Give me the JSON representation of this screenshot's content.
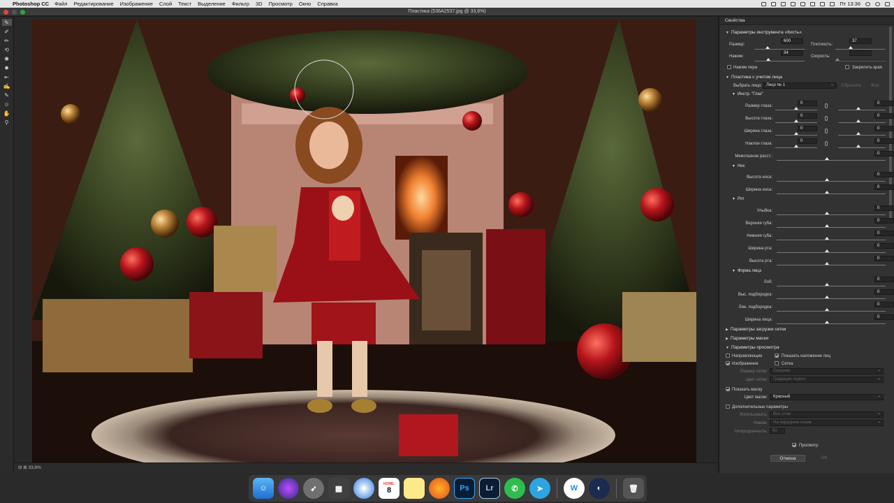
{
  "menubar": {
    "app_name": "Photoshop CC",
    "items": [
      "Файл",
      "Редактирование",
      "Изображение",
      "Слой",
      "Текст",
      "Выделение",
      "Фильтр",
      "3D",
      "Просмотр",
      "Окно",
      "Справка"
    ],
    "clock": "Пт 13:36"
  },
  "window": {
    "title": "Пластика (536A2537.jpg @ 33,6%)"
  },
  "statusbar": {
    "zoom": "33,6%"
  },
  "panel": {
    "header": "Свойства",
    "brush": {
      "title": "Параметры инструмента «Кисть»",
      "size_label": "Размер:",
      "size_value": "600",
      "density_label": "Плотность:",
      "density_value": "37",
      "pressure_label": "Нажим:",
      "pressure_value": "34",
      "rate_label": "Скорость:",
      "rate_value": "",
      "stylus_label": "Нажим пера",
      "pin_label": "Закрепить края"
    },
    "face": {
      "title": "Пластика с учетом лица",
      "select_label": "Выбрать лицо:",
      "select_value": "Лицо № 1",
      "reset_label": "Сбросить",
      "all_label": "Все",
      "eyes_title": "Инстр. \"Глаз\"",
      "eyes": [
        {
          "label": "Размер глаза:",
          "left": "0",
          "right": "0"
        },
        {
          "label": "Высота глаза:",
          "left": "0",
          "right": "0"
        },
        {
          "label": "Ширина глаза:",
          "left": "0",
          "right": "0"
        },
        {
          "label": "Наклон глаза:",
          "left": "0",
          "right": "0"
        }
      ],
      "eye_distance": {
        "label": "Межглазное расст.:",
        "value": "0"
      },
      "nose_title": "Нос",
      "nose": [
        {
          "label": "Высота носа:",
          "value": "0"
        },
        {
          "label": "Ширина носа:",
          "value": "0"
        }
      ],
      "mouth_title": "Рот",
      "mouth": [
        {
          "label": "Улыбка:",
          "value": "0"
        },
        {
          "label": "Верхняя губа:",
          "value": "0"
        },
        {
          "label": "Нижняя губа:",
          "value": "0"
        },
        {
          "label": "Ширина рта:",
          "value": "0"
        },
        {
          "label": "Высота рта:",
          "value": "0"
        }
      ],
      "shape_title": "Форма лица",
      "shape": [
        {
          "label": "Лоб:",
          "value": "0"
        },
        {
          "label": "Выс. подбородка:",
          "value": "0"
        },
        {
          "label": "Лин. подбородка:",
          "value": "0"
        },
        {
          "label": "Ширина лица:",
          "value": "0"
        }
      ]
    },
    "mesh_title": "Параметры загрузки сетки",
    "mask_title": "Параметры маски",
    "view": {
      "title": "Параметры просмотра",
      "guides_label": "Направляющие",
      "face_overlay_label": "Показать наложение лиц",
      "image_label": "Изображение",
      "mesh_label": "Сетка",
      "mesh_size_label": "Размер сетки:",
      "mesh_size_value": "Средние",
      "mesh_color_label": "Цвет сетки:",
      "mesh_color_value": "Градации серого",
      "show_mask_label": "Показать маску",
      "mask_color_label": "Цвет маски:",
      "mask_color_value": "Красный"
    },
    "extra": {
      "title": "Дополнительные параметры",
      "use_label": "Использовать:",
      "use_value": "Все слои",
      "mode_label": "Режим:",
      "mode_value": "На переднем плане",
      "opacity_label": "Непрозрачность:",
      "opacity_value": "50"
    },
    "preview_label": "Просмотр",
    "cancel_label": "Отмена",
    "ok_label": "OK"
  },
  "dock": {
    "calendar_month": "НОЯБ.",
    "calendar_day": "8",
    "ps": "Ps",
    "lr": "Lr"
  },
  "colors": {
    "accent": "#2d8cf0",
    "mask_red": "#c0282d"
  }
}
